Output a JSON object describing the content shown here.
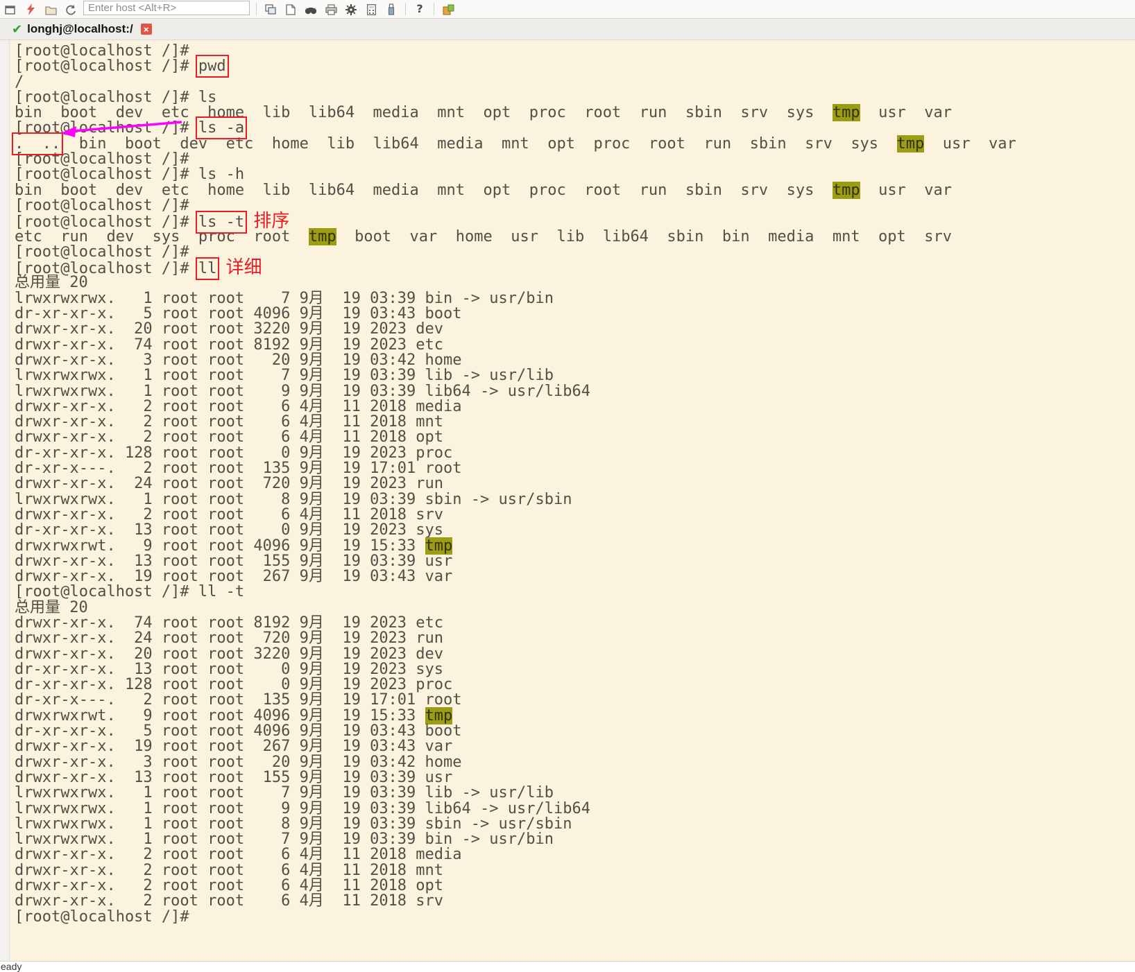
{
  "toolbar": {
    "host_placeholder": "Enter host <Alt+R>",
    "icon_names": [
      "new-session-icon",
      "connect-icon",
      "open-folder-icon",
      "reconnect-icon",
      "duplicate-session-icon",
      "new-file-icon",
      "find-icon",
      "print-icon",
      "settings-icon",
      "calculator-icon",
      "usb-transfer-icon",
      "help-icon",
      "package-icon"
    ],
    "help_glyph": "?"
  },
  "tabbar": {
    "tab_title": "longhj@localhost:/",
    "close_glyph": "×",
    "check_glyph": "✔"
  },
  "statusbar": {
    "text": "eady"
  },
  "colors": {
    "terminal_bg": "#fbf3dd",
    "terminal_text": "#515047",
    "highlight_bg": "#9c9c15",
    "annotation_red": "#ec1c24",
    "arrow_magenta": "#ff00ff",
    "tab_close_red": "#e05548"
  },
  "terminal": {
    "lines": [
      [
        [
          "p",
          "[root@localhost /]#"
        ]
      ],
      [
        [
          "p",
          "[root@localhost /]# "
        ],
        [
          "b",
          "pwd"
        ]
      ],
      [
        [
          "p",
          "/"
        ]
      ],
      [
        [
          "p",
          "[root@localhost /]# ls"
        ]
      ],
      [
        [
          "p",
          "bin  boot  dev  etc  home  lib  lib64  media  mnt  opt  proc  root  run  sbin  srv  sys  "
        ],
        [
          "h",
          "tmp"
        ],
        [
          "p",
          "  usr  var"
        ]
      ],
      [
        [
          "p",
          "[root@localhost /]# "
        ],
        [
          "b",
          "ls -a"
        ]
      ],
      [
        [
          "b",
          ".  .."
        ],
        [
          "p",
          "  bin  boot  dev  etc  home  lib  lib64  media  mnt  opt  proc  root  run  sbin  srv  sys  "
        ],
        [
          "h",
          "tmp"
        ],
        [
          "p",
          "  usr  var"
        ]
      ],
      [
        [
          "p",
          "[root@localhost /]#"
        ]
      ],
      [
        [
          "p",
          "[root@localhost /]# ls -h"
        ]
      ],
      [
        [
          "p",
          "bin  boot  dev  etc  home  lib  lib64  media  mnt  opt  proc  root  run  sbin  srv  sys  "
        ],
        [
          "h",
          "tmp"
        ],
        [
          "p",
          "  usr  var"
        ]
      ],
      [
        [
          "p",
          "[root@localhost /]#"
        ]
      ],
      [
        [
          "p",
          "[root@localhost /]# "
        ],
        [
          "b",
          "ls -t"
        ],
        [
          "p",
          " "
        ],
        [
          "a",
          "排序"
        ]
      ],
      [
        [
          "p",
          "etc  run  dev  sys  proc  root  "
        ],
        [
          "h",
          "tmp"
        ],
        [
          "p",
          "  boot  var  home  usr  lib  lib64  sbin  bin  media  mnt  opt  srv"
        ]
      ],
      [
        [
          "p",
          "[root@localhost /]#"
        ]
      ],
      [
        [
          "p",
          "[root@localhost /]# "
        ],
        [
          "b",
          "ll"
        ],
        [
          "p",
          " "
        ],
        [
          "a",
          "详细"
        ]
      ],
      [
        [
          "p",
          "总用量 20"
        ]
      ],
      [
        [
          "p",
          "lrwxrwxrwx.   1 root root    7 9月  19 03:39 bin -> usr/bin"
        ]
      ],
      [
        [
          "p",
          "dr-xr-xr-x.   5 root root 4096 9月  19 03:43 boot"
        ]
      ],
      [
        [
          "p",
          "drwxr-xr-x.  20 root root 3220 9月  19 2023 dev"
        ]
      ],
      [
        [
          "p",
          "drwxr-xr-x.  74 root root 8192 9月  19 2023 etc"
        ]
      ],
      [
        [
          "p",
          "drwxr-xr-x.   3 root root   20 9月  19 03:42 home"
        ]
      ],
      [
        [
          "p",
          "lrwxrwxrwx.   1 root root    7 9月  19 03:39 lib -> usr/lib"
        ]
      ],
      [
        [
          "p",
          "lrwxrwxrwx.   1 root root    9 9月  19 03:39 lib64 -> usr/lib64"
        ]
      ],
      [
        [
          "p",
          "drwxr-xr-x.   2 root root    6 4月  11 2018 media"
        ]
      ],
      [
        [
          "p",
          "drwxr-xr-x.   2 root root    6 4月  11 2018 mnt"
        ]
      ],
      [
        [
          "p",
          "drwxr-xr-x.   2 root root    6 4月  11 2018 opt"
        ]
      ],
      [
        [
          "p",
          "dr-xr-xr-x. 128 root root    0 9月  19 2023 proc"
        ]
      ],
      [
        [
          "p",
          "dr-xr-x---.   2 root root  135 9月  19 17:01 root"
        ]
      ],
      [
        [
          "p",
          "drwxr-xr-x.  24 root root  720 9月  19 2023 run"
        ]
      ],
      [
        [
          "p",
          "lrwxrwxrwx.   1 root root    8 9月  19 03:39 sbin -> usr/sbin"
        ]
      ],
      [
        [
          "p",
          "drwxr-xr-x.   2 root root    6 4月  11 2018 srv"
        ]
      ],
      [
        [
          "p",
          "dr-xr-xr-x.  13 root root    0 9月  19 2023 sys"
        ]
      ],
      [
        [
          "p",
          "drwxrwxrwt.   9 root root 4096 9月  19 15:33 "
        ],
        [
          "h",
          "tmp"
        ]
      ],
      [
        [
          "p",
          "drwxr-xr-x.  13 root root  155 9月  19 03:39 usr"
        ]
      ],
      [
        [
          "p",
          "drwxr-xr-x.  19 root root  267 9月  19 03:43 var"
        ]
      ],
      [
        [
          "p",
          "[root@localhost /]# ll -t"
        ]
      ],
      [
        [
          "p",
          "总用量 20"
        ]
      ],
      [
        [
          "p",
          "drwxr-xr-x.  74 root root 8192 9月  19 2023 etc"
        ]
      ],
      [
        [
          "p",
          "drwxr-xr-x.  24 root root  720 9月  19 2023 run"
        ]
      ],
      [
        [
          "p",
          "drwxr-xr-x.  20 root root 3220 9月  19 2023 dev"
        ]
      ],
      [
        [
          "p",
          "dr-xr-xr-x.  13 root root    0 9月  19 2023 sys"
        ]
      ],
      [
        [
          "p",
          "dr-xr-xr-x. 128 root root    0 9月  19 2023 proc"
        ]
      ],
      [
        [
          "p",
          "dr-xr-x---.   2 root root  135 9月  19 17:01 root"
        ]
      ],
      [
        [
          "p",
          "drwxrwxrwt.   9 root root 4096 9月  19 15:33 "
        ],
        [
          "h",
          "tmp"
        ]
      ],
      [
        [
          "p",
          "dr-xr-xr-x.   5 root root 4096 9月  19 03:43 boot"
        ]
      ],
      [
        [
          "p",
          "drwxr-xr-x.  19 root root  267 9月  19 03:43 var"
        ]
      ],
      [
        [
          "p",
          "drwxr-xr-x.   3 root root   20 9月  19 03:42 home"
        ]
      ],
      [
        [
          "p",
          "drwxr-xr-x.  13 root root  155 9月  19 03:39 usr"
        ]
      ],
      [
        [
          "p",
          "lrwxrwxrwx.   1 root root    7 9月  19 03:39 lib -> usr/lib"
        ]
      ],
      [
        [
          "p",
          "lrwxrwxrwx.   1 root root    9 9月  19 03:39 lib64 -> usr/lib64"
        ]
      ],
      [
        [
          "p",
          "lrwxrwxrwx.   1 root root    8 9月  19 03:39 sbin -> usr/sbin"
        ]
      ],
      [
        [
          "p",
          "lrwxrwxrwx.   1 root root    7 9月  19 03:39 bin -> usr/bin"
        ]
      ],
      [
        [
          "p",
          "drwxr-xr-x.   2 root root    6 4月  11 2018 media"
        ]
      ],
      [
        [
          "p",
          "drwxr-xr-x.   2 root root    6 4月  11 2018 mnt"
        ]
      ],
      [
        [
          "p",
          "drwxr-xr-x.   2 root root    6 4月  11 2018 opt"
        ]
      ],
      [
        [
          "p",
          "drwxr-xr-x.   2 root root    6 4月  11 2018 srv"
        ]
      ],
      [
        [
          "p",
          "[root@localhost /]#"
        ]
      ]
    ]
  }
}
